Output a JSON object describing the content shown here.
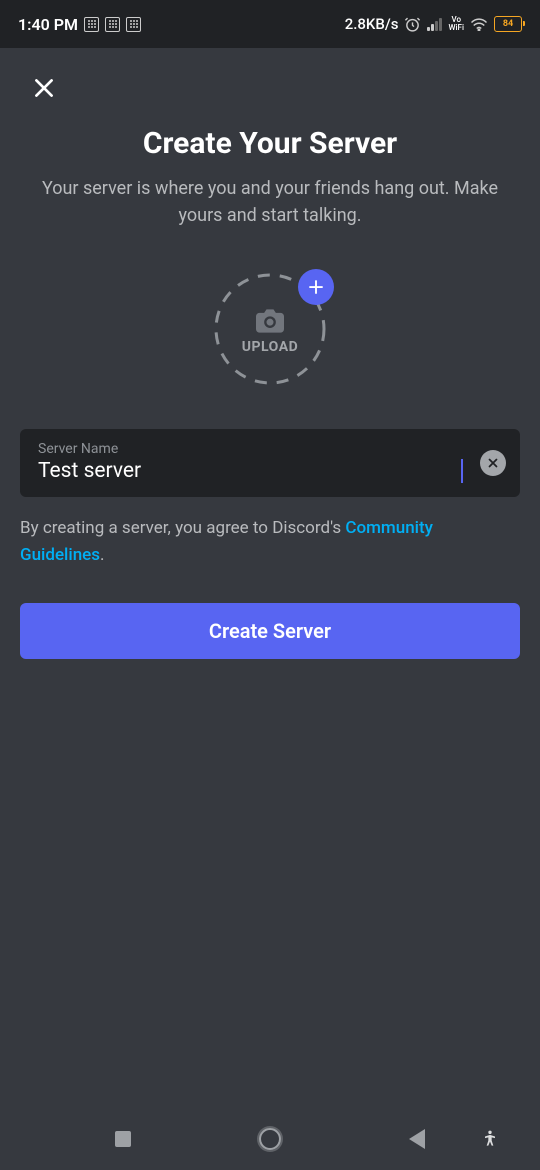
{
  "status_bar": {
    "time": "1:40 PM",
    "data_rate": "2.8KB/s",
    "battery_percent": "84",
    "vo_line1": "Vo",
    "vo_line2": "WiFi"
  },
  "page": {
    "title": "Create Your Server",
    "subtitle": "Your server is where you and your friends hang out. Make yours and start talking."
  },
  "upload": {
    "label": "UPLOAD"
  },
  "input": {
    "label": "Server Name",
    "value": "Test server"
  },
  "agreement": {
    "prefix": "By creating a server, you agree to Discord's ",
    "link_text": "Community Guidelines",
    "suffix": "."
  },
  "create_button": {
    "label": "Create Server"
  }
}
